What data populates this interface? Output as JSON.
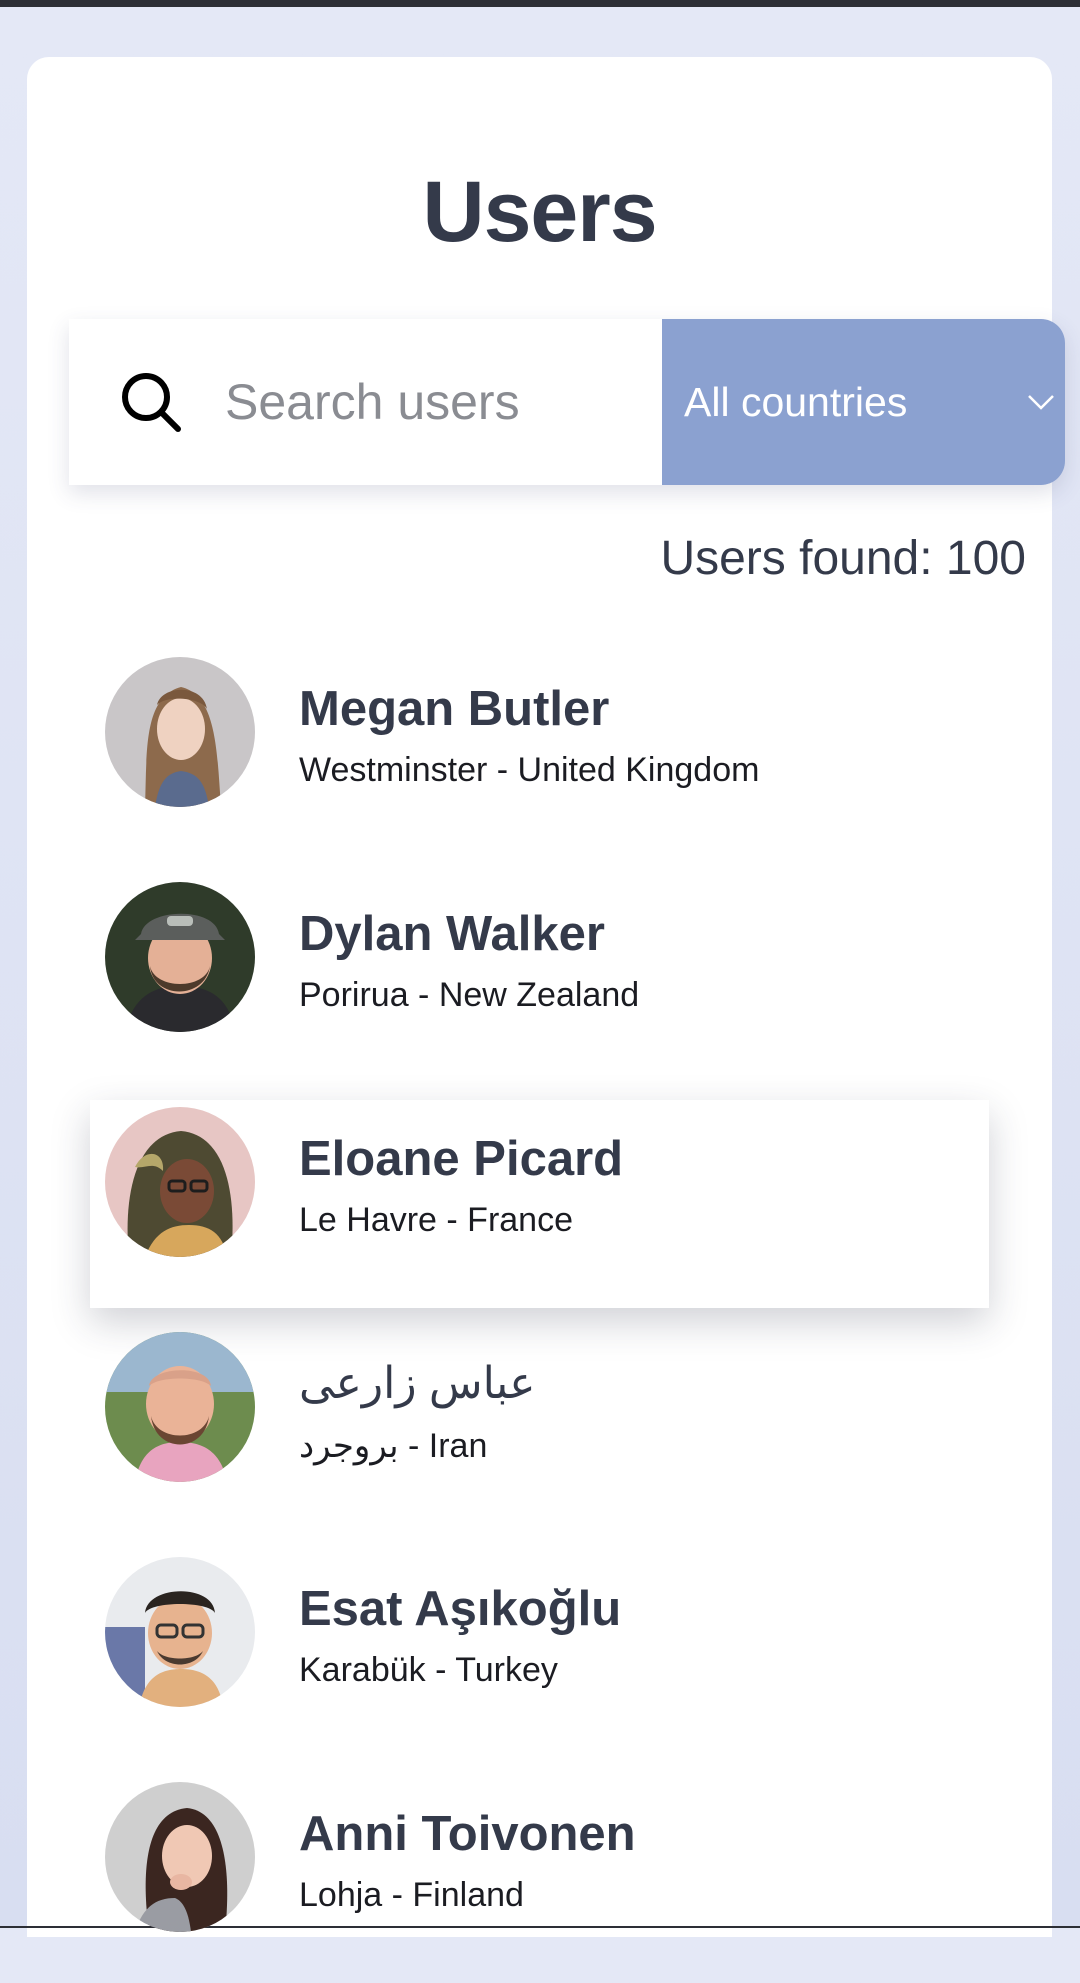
{
  "page": {
    "title": "Users",
    "users_found": "Users found: 100"
  },
  "search": {
    "placeholder": "Search users",
    "value": ""
  },
  "country_filter": {
    "selected": "All countries",
    "color": "#8ba1d0"
  },
  "icons": {
    "search": "search-icon",
    "dropdown": "chevron-down-icon"
  },
  "colors": {
    "text": "#343a4a",
    "accent": "#8ba1d0",
    "background": "#e4e8f6"
  },
  "users": [
    {
      "name": "Megan Butler",
      "location": "Westminster - United Kingdom",
      "highlighted": false
    },
    {
      "name": "Dylan Walker",
      "location": "Porirua - New Zealand",
      "highlighted": false
    },
    {
      "name": "Eloane Picard",
      "location": "Le Havre - France",
      "highlighted": true
    },
    {
      "name": "عباس زارعی",
      "location": "بروجرد - Iran",
      "highlighted": false
    },
    {
      "name": "Esat Aşıkoğlu",
      "location": "Karabük - Turkey",
      "highlighted": false
    },
    {
      "name": "Anni Toivonen",
      "location": "Lohja - Finland",
      "highlighted": false
    }
  ]
}
